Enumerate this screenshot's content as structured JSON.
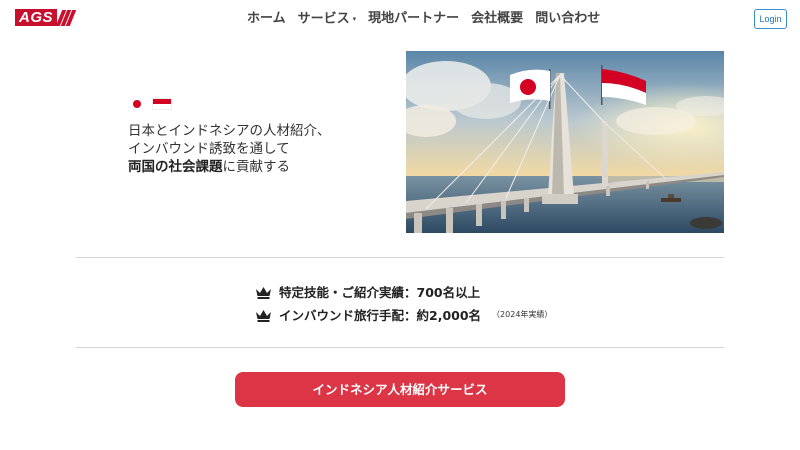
{
  "header": {
    "logo_text": "AGS",
    "nav": [
      {
        "label": "ホーム"
      },
      {
        "label": "サービス"
      },
      {
        "label": "現地パートナー"
      },
      {
        "label": "会社概要"
      },
      {
        "label": "問い合わせ"
      }
    ],
    "login_label": "Login"
  },
  "hero": {
    "line1": "日本とインドネシアの人材紹介、",
    "line2": "インバウンド誘致を通して",
    "line3_bold": "両国の社会課題",
    "line3_rest": "に貢献する"
  },
  "stats": [
    {
      "text": "特定技能・ご紹介実績：700名以上",
      "note": ""
    },
    {
      "text": "インバウンド旅行手配：約2,000名",
      "note": "（2024年実績）"
    }
  ],
  "cta": {
    "label": "インドネシア人材紹介サービス"
  },
  "colors": {
    "brand_red": "#c8102e",
    "cta_red": "#dc3545",
    "login_blue": "#1f74c4"
  },
  "icons": {
    "stat_icon": "crown-icon",
    "nav_dropdown": "caret-down-icon"
  }
}
